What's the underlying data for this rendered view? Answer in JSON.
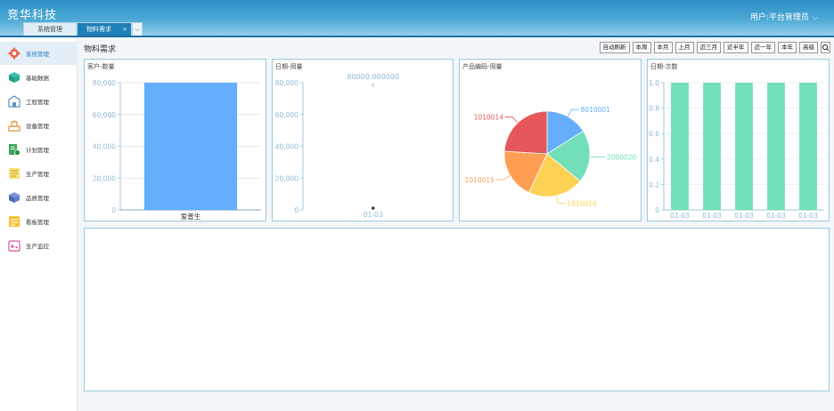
{
  "app": {
    "brand": "竞华科技"
  },
  "user": {
    "label": "用户:平台管理员",
    "caret": "⌵"
  },
  "tabs": [
    {
      "label": "系统管理"
    },
    {
      "label": "物料需求",
      "close": "×"
    },
    {
      "label": "⌵"
    }
  ],
  "sidebar": {
    "collapse": "«",
    "items": [
      {
        "label": "系统管理",
        "icon": "gear-icon"
      },
      {
        "label": "基础数据",
        "icon": "cube-icon"
      },
      {
        "label": "工程管理",
        "icon": "factory-icon"
      },
      {
        "label": "设备管理",
        "icon": "machine-icon"
      },
      {
        "label": "计划管理",
        "icon": "plan-icon"
      },
      {
        "label": "生产管理",
        "icon": "production-icon"
      },
      {
        "label": "品质管理",
        "icon": "quality-box-icon"
      },
      {
        "label": "看板管理",
        "icon": "board-icon"
      },
      {
        "label": "生产监控",
        "icon": "monitor-icon"
      }
    ]
  },
  "page": {
    "title": "物料需求"
  },
  "toolbar": {
    "buttons": [
      "自动刷新",
      "本周",
      "本月",
      "上月",
      "近三月",
      "近半年",
      "近一年",
      "本年",
      "高级"
    ],
    "search_icon": "search-icon"
  },
  "colors": {
    "blue": "#64aefc",
    "green": "#72dfb9",
    "axis": "#8fb8d8"
  },
  "chart_data": [
    {
      "type": "bar",
      "title": "客户-数量",
      "categories": [
        "爱普生"
      ],
      "values": [
        80000
      ],
      "ylim": [
        0,
        80000
      ],
      "yticks": [
        "0",
        "20,000",
        "40,000",
        "60,000",
        "80,000"
      ],
      "grid": true
    },
    {
      "type": "scatter",
      "title": "日期-用量",
      "categories": [
        "01-03"
      ],
      "values": [
        80000
      ],
      "data_label": "80000.000000",
      "ylim": [
        0,
        80000
      ],
      "yticks": [
        "0",
        "20,000",
        "40,000",
        "60,000",
        "80,000"
      ]
    },
    {
      "type": "pie",
      "title": "产品编码-用量",
      "slices": [
        {
          "label": "8010001",
          "value": 16,
          "color": "#64aefc"
        },
        {
          "label": "2000020",
          "value": 20,
          "color": "#72dfb9"
        },
        {
          "label": "1010016",
          "value": 21,
          "color": "#fdd153"
        },
        {
          "label": "1010015",
          "value": 19,
          "color": "#fd9e53"
        },
        {
          "label": "1010014",
          "value": 24,
          "color": "#e5575a"
        }
      ]
    },
    {
      "type": "bar",
      "title": "日期-次数",
      "categories": [
        "01-03",
        "01-03",
        "01-03",
        "01-03",
        "01-03"
      ],
      "values": [
        1,
        1,
        1,
        1,
        1
      ],
      "ylim": [
        0,
        1
      ],
      "yticks": [
        "0",
        "0.2",
        "0.4",
        "0.6",
        "0.8",
        "1.0"
      ],
      "grid": true
    }
  ]
}
